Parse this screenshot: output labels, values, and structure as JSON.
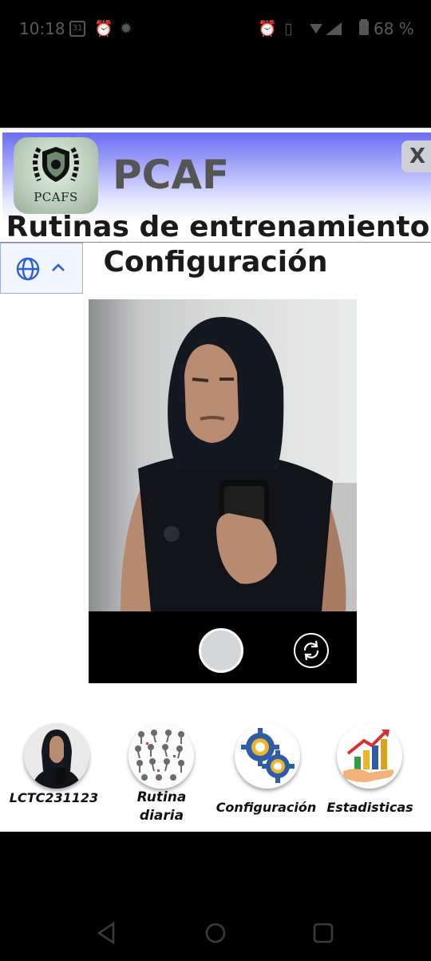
{
  "status_bar": {
    "time": "10:18",
    "calendar_day": "31",
    "battery_text": "68 %"
  },
  "header": {
    "logo_text": "PCAFS",
    "app_name": "PCAF",
    "close_label": "X",
    "subtitle": "Rutinas de entrenamiento",
    "section_title": "Configuración"
  },
  "language": {
    "icon": "globe-icon",
    "toggle_icon": "chevron-up-icon"
  },
  "camera": {
    "shutter_icon": "shutter-button",
    "switch_icon": "switch-camera-icon"
  },
  "bottom_nav": {
    "items": [
      {
        "label": "LCTC231123",
        "icon": "profile-avatar"
      },
      {
        "label": "Rutina diaria",
        "line1": "Rutina",
        "line2": "diaria",
        "icon": "exercise-grid-icon"
      },
      {
        "label": "Configuración",
        "icon": "gears-icon"
      },
      {
        "label": "Estadisticas",
        "icon": "growth-chart-icon"
      }
    ]
  },
  "colors": {
    "header_gradient_top": "#6b6ef2",
    "header_gradient_bottom": "#ffffff",
    "title_text": "#1a1a1a",
    "app_name": "#555555"
  }
}
